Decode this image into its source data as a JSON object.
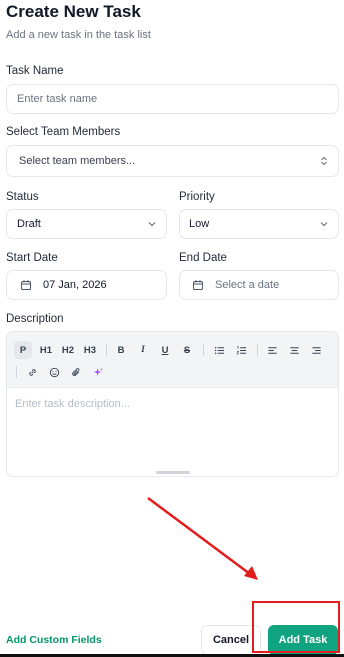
{
  "header": {
    "title": "Create New Task",
    "subtitle": "Add a new task in the task list"
  },
  "form": {
    "task_name": {
      "label": "Task Name",
      "placeholder": "Enter task name"
    },
    "team_members": {
      "label": "Select Team Members",
      "placeholder": "Select team members..."
    },
    "status": {
      "label": "Status",
      "value": "Draft"
    },
    "priority": {
      "label": "Priority",
      "value": "Low"
    },
    "start_date": {
      "label": "Start Date",
      "value": "07 Jan, 2026"
    },
    "end_date": {
      "label": "End Date",
      "placeholder": "Select a date"
    },
    "description": {
      "label": "Description",
      "placeholder": "Enter task description...",
      "toolbar": {
        "paragraph": "P",
        "h1": "H1",
        "h2": "H2",
        "h3": "H3",
        "bold": "B",
        "italic": "I",
        "underline": "U",
        "strike": "S"
      }
    }
  },
  "footer": {
    "custom_fields_label": "Add Custom Fields",
    "cancel_label": "Cancel",
    "add_task_label": "Add Task"
  },
  "icons": {
    "chevron": "chevron-down-icon",
    "calendar": "calendar-icon",
    "link": "link-icon",
    "emoji": "emoji-icon",
    "attachment": "paperclip-icon",
    "ai": "sparkles-icon"
  },
  "colors": {
    "accent": "#10a37f",
    "link": "#059669",
    "annotation": "#e11d1d"
  }
}
